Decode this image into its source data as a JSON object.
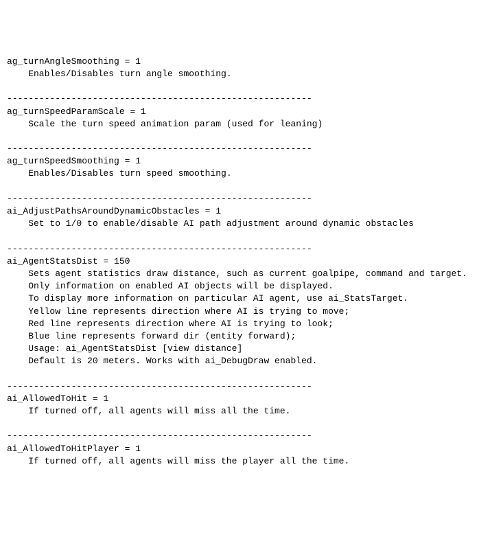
{
  "separator": "---------------------------------------------------------",
  "entries": [
    {
      "name": "ag_turnAngleSmoothing",
      "value": "1",
      "description": [
        "Enables/Disables turn angle smoothing."
      ]
    },
    {
      "name": "ag_turnSpeedParamScale",
      "value": "1",
      "description": [
        "Scale the turn speed animation param (used for leaning)"
      ]
    },
    {
      "name": "ag_turnSpeedSmoothing",
      "value": "1",
      "description": [
        "Enables/Disables turn speed smoothing."
      ]
    },
    {
      "name": "ai_AdjustPathsAroundDynamicObstacles",
      "value": "1",
      "description": [
        "Set to 1/0 to enable/disable AI path adjustment around dynamic obstacles"
      ]
    },
    {
      "name": "ai_AgentStatsDist",
      "value": "150",
      "description": [
        "Sets agent statistics draw distance, such as current goalpipe, command and target.",
        "Only information on enabled AI objects will be displayed.",
        "To display more information on particular AI agent, use ai_StatsTarget.",
        "Yellow line represents direction where AI is trying to move;",
        "Red line represents direction where AI is trying to look;",
        "Blue line represents forward dir (entity forward);",
        "Usage: ai_AgentStatsDist [view distance]",
        "Default is 20 meters. Works with ai_DebugDraw enabled."
      ]
    },
    {
      "name": "ai_AllowedToHit",
      "value": "1",
      "description": [
        "If turned off, all agents will miss all the time."
      ]
    },
    {
      "name": "ai_AllowedToHitPlayer",
      "value": "1",
      "description": [
        "If turned off, all agents will miss the player all the time."
      ]
    }
  ]
}
